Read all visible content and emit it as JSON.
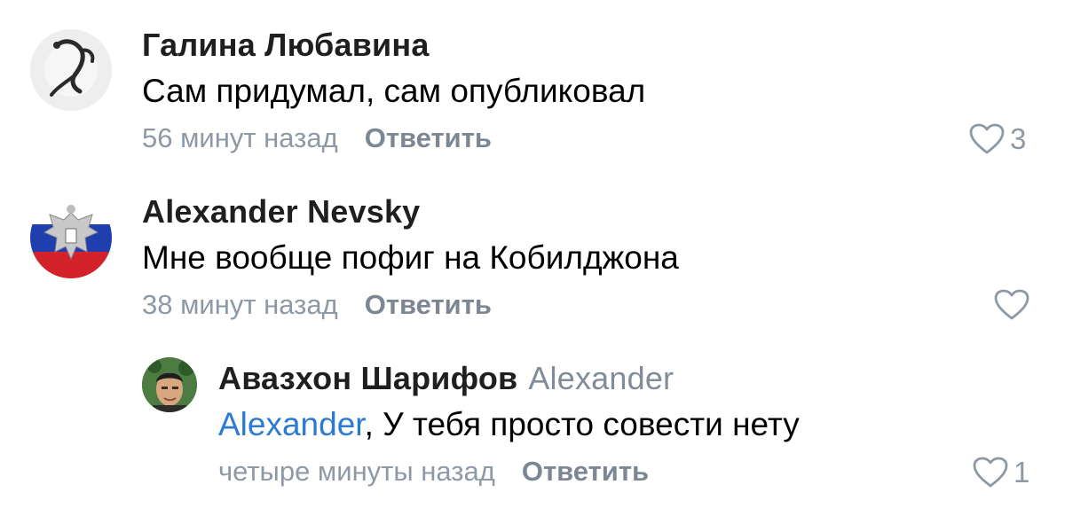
{
  "comments": [
    {
      "author": "Галина Любавина",
      "text": "Сам придумал, сам опубликовал",
      "time": "56 минут назад",
      "reply_label": "Ответить",
      "likes": "3",
      "avatar_icon": "gymnast-photo-avatar"
    },
    {
      "author": "Alexander Nevsky",
      "text": "Мне вообще пофиг на Кобилджона",
      "time": "38 минут назад",
      "reply_label": "Ответить",
      "likes": "",
      "avatar_icon": "russian-coat-of-arms-avatar"
    },
    {
      "author": "Авазхон Шарифов",
      "reply_to": "Alexander",
      "mention": "Alexander",
      "text": ", У тебя просто совести нету",
      "time": "четыре минуты назад",
      "reply_label": "Ответить",
      "likes": "1",
      "avatar_icon": "man-photo-avatar"
    }
  ],
  "colors": {
    "author": "#1f1f1f",
    "meta": "#8e99a6",
    "mention": "#2a7ad6",
    "reply_button": "#7d8794"
  }
}
